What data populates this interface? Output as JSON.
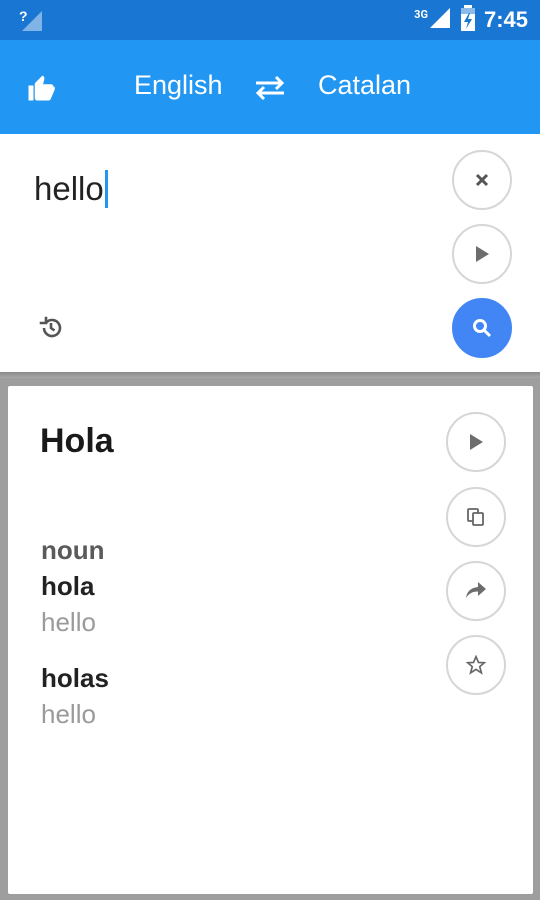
{
  "status_bar": {
    "signal_left": "?",
    "network": "3G",
    "time": "7:45"
  },
  "toolbar": {
    "like_icon": "thumb-up-icon",
    "source_language": "English",
    "swap_icon": "swap-icon",
    "target_language": "Catalan"
  },
  "input": {
    "text": "hello",
    "icons": {
      "clear": "close-icon",
      "play": "play-icon",
      "search": "search-icon",
      "history": "history-icon"
    }
  },
  "result": {
    "translation": "Hola",
    "entries": [
      {
        "part_of_speech": "noun",
        "word": "hola",
        "gloss": "hello"
      },
      {
        "word": "holas",
        "gloss": "hello"
      }
    ],
    "icons": {
      "play": "play-icon",
      "copy": "copy-icon",
      "share": "share-icon",
      "favorite": "star-icon"
    }
  },
  "colors": {
    "status_bar": "#1976d2",
    "toolbar": "#2196f3",
    "search_button": "#4285f4",
    "background": "#9e9e9e"
  }
}
